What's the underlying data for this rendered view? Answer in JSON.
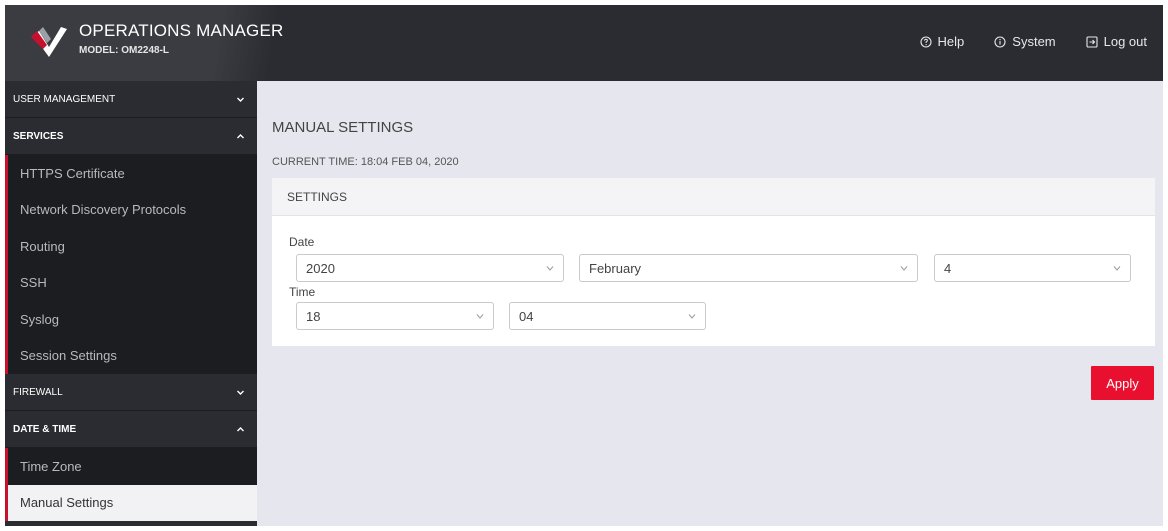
{
  "header": {
    "title": "OPERATIONS MANAGER",
    "model": "MODEL: OM2248-L",
    "nav": [
      {
        "label": "Help",
        "icon": "help-circle-icon"
      },
      {
        "label": "System",
        "icon": "info-circle-icon"
      },
      {
        "label": "Log out",
        "icon": "logout-icon"
      }
    ]
  },
  "sidebar": {
    "sections": [
      {
        "label": "USER MANAGEMENT",
        "expanded": false
      },
      {
        "label": "SERVICES",
        "expanded": true,
        "items": [
          "HTTPS Certificate",
          "Network Discovery Protocols",
          "Routing",
          "SSH",
          "Syslog",
          "Session Settings"
        ]
      },
      {
        "label": "FIREWALL",
        "expanded": false
      },
      {
        "label": "DATE & TIME",
        "expanded": true,
        "items": [
          "Time Zone",
          "Manual Settings"
        ],
        "active_item": "Manual Settings"
      }
    ]
  },
  "main": {
    "title": "MANUAL SETTINGS",
    "current_time": "CURRENT TIME: 18:04 FEB 04, 2020",
    "panel_title": "SETTINGS",
    "date_label": "Date",
    "time_label": "Time",
    "date": {
      "year": "2020",
      "month": "February",
      "day": "4"
    },
    "time": {
      "hour": "18",
      "minute": "04"
    },
    "apply_label": "Apply"
  },
  "colors": {
    "header_bg": "#2a2c31",
    "sidebar_bg": "#2a2c31",
    "content_bg": "#e6e6ee",
    "accent": "#e8102e"
  }
}
